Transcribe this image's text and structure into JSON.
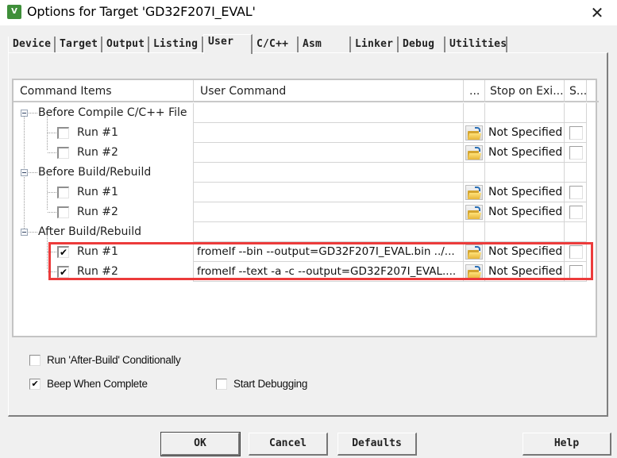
{
  "window": {
    "title": "Options for Target 'GD32F207I_EVAL'",
    "app_icon": "uv-logo-icon",
    "close_symbol": "✕"
  },
  "tabs": [
    {
      "label": "Device",
      "active": false
    },
    {
      "label": "Target",
      "active": false
    },
    {
      "label": "Output",
      "active": false
    },
    {
      "label": "Listing",
      "active": false
    },
    {
      "label": "User",
      "active": true
    },
    {
      "label": "C/C++",
      "active": false
    },
    {
      "label": "Asm",
      "active": false
    },
    {
      "label": "Linker",
      "active": false
    },
    {
      "label": "Debug",
      "active": false
    },
    {
      "label": "Utilities",
      "active": false
    }
  ],
  "grid": {
    "columns": [
      "Command Items",
      "User Command",
      "...",
      "Stop on Exi...",
      "S..."
    ],
    "groups": [
      {
        "label": "Before Compile C/C++ File",
        "expanded": true,
        "runs": [
          {
            "label": "Run #1",
            "checked": false,
            "command": "",
            "stop_on_exit": "Not Specified",
            "s_checked": false
          },
          {
            "label": "Run #2",
            "checked": false,
            "command": "",
            "stop_on_exit": "Not Specified",
            "s_checked": false
          }
        ]
      },
      {
        "label": "Before Build/Rebuild",
        "expanded": true,
        "runs": [
          {
            "label": "Run #1",
            "checked": false,
            "command": "",
            "stop_on_exit": "Not Specified",
            "s_checked": false
          },
          {
            "label": "Run #2",
            "checked": false,
            "command": "",
            "stop_on_exit": "Not Specified",
            "s_checked": false
          }
        ]
      },
      {
        "label": "After Build/Rebuild",
        "expanded": true,
        "runs": [
          {
            "label": "Run #1",
            "checked": true,
            "command": "fromelf  --bin  --output=GD32F207I_EVAL.bin  ../...",
            "stop_on_exit": "Not Specified",
            "s_checked": false
          },
          {
            "label": "Run #2",
            "checked": true,
            "command": "fromelf  --text  -a -c  --output=GD32F207I_EVAL....",
            "stop_on_exit": "Not Specified",
            "s_checked": false
          }
        ]
      }
    ],
    "highlight_color": "#ec3b3b"
  },
  "options": {
    "run_after_build_conditionally": {
      "label": "Run 'After-Build' Conditionally",
      "checked": false
    },
    "beep_when_complete": {
      "label": "Beep When Complete",
      "checked": true
    },
    "start_debugging": {
      "label": "Start Debugging",
      "checked": false
    }
  },
  "buttons": {
    "ok": "OK",
    "cancel": "Cancel",
    "defaults": "Defaults",
    "help": "Help"
  },
  "check_mark": "✔"
}
